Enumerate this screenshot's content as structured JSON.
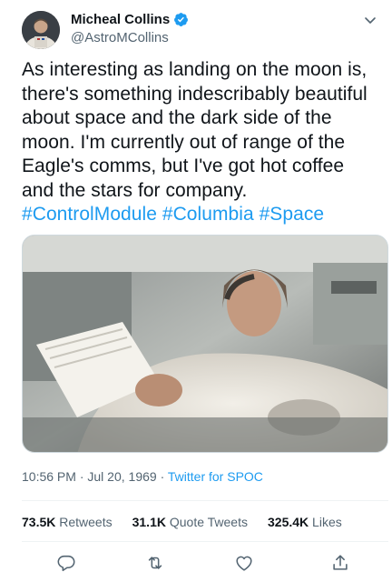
{
  "author": {
    "name": "Micheal Collins",
    "handle": "@AstroMCollins",
    "verified": true
  },
  "tweet": {
    "text": "As interesting as landing on the moon is, there's something indescribably beautiful about space and the dark side of the moon. I'm currently out of range of the Eagle's comms, but I've got hot coffee and the stars for company.",
    "hashtags": [
      "#ControlModule",
      "#Columbia",
      "#Space"
    ]
  },
  "meta": {
    "time": "10:56 PM",
    "date": "Jul 20, 1969",
    "source": "Twitter for SPOC",
    "separator": "·"
  },
  "stats": {
    "retweets_count": "73.5K",
    "retweets_label": "Retweets",
    "quotes_count": "31.1K",
    "quotes_label": "Quote Tweets",
    "likes_count": "325.4K",
    "likes_label": "Likes"
  },
  "colors": {
    "accent": "#1d9bf0",
    "text": "#0f1419",
    "secondary": "#536471"
  },
  "icons": {
    "reply": "reply-icon",
    "retweet": "retweet-icon",
    "like": "heart-icon",
    "share": "share-icon",
    "more": "chevron-down-icon",
    "verified": "verified-badge-icon"
  }
}
